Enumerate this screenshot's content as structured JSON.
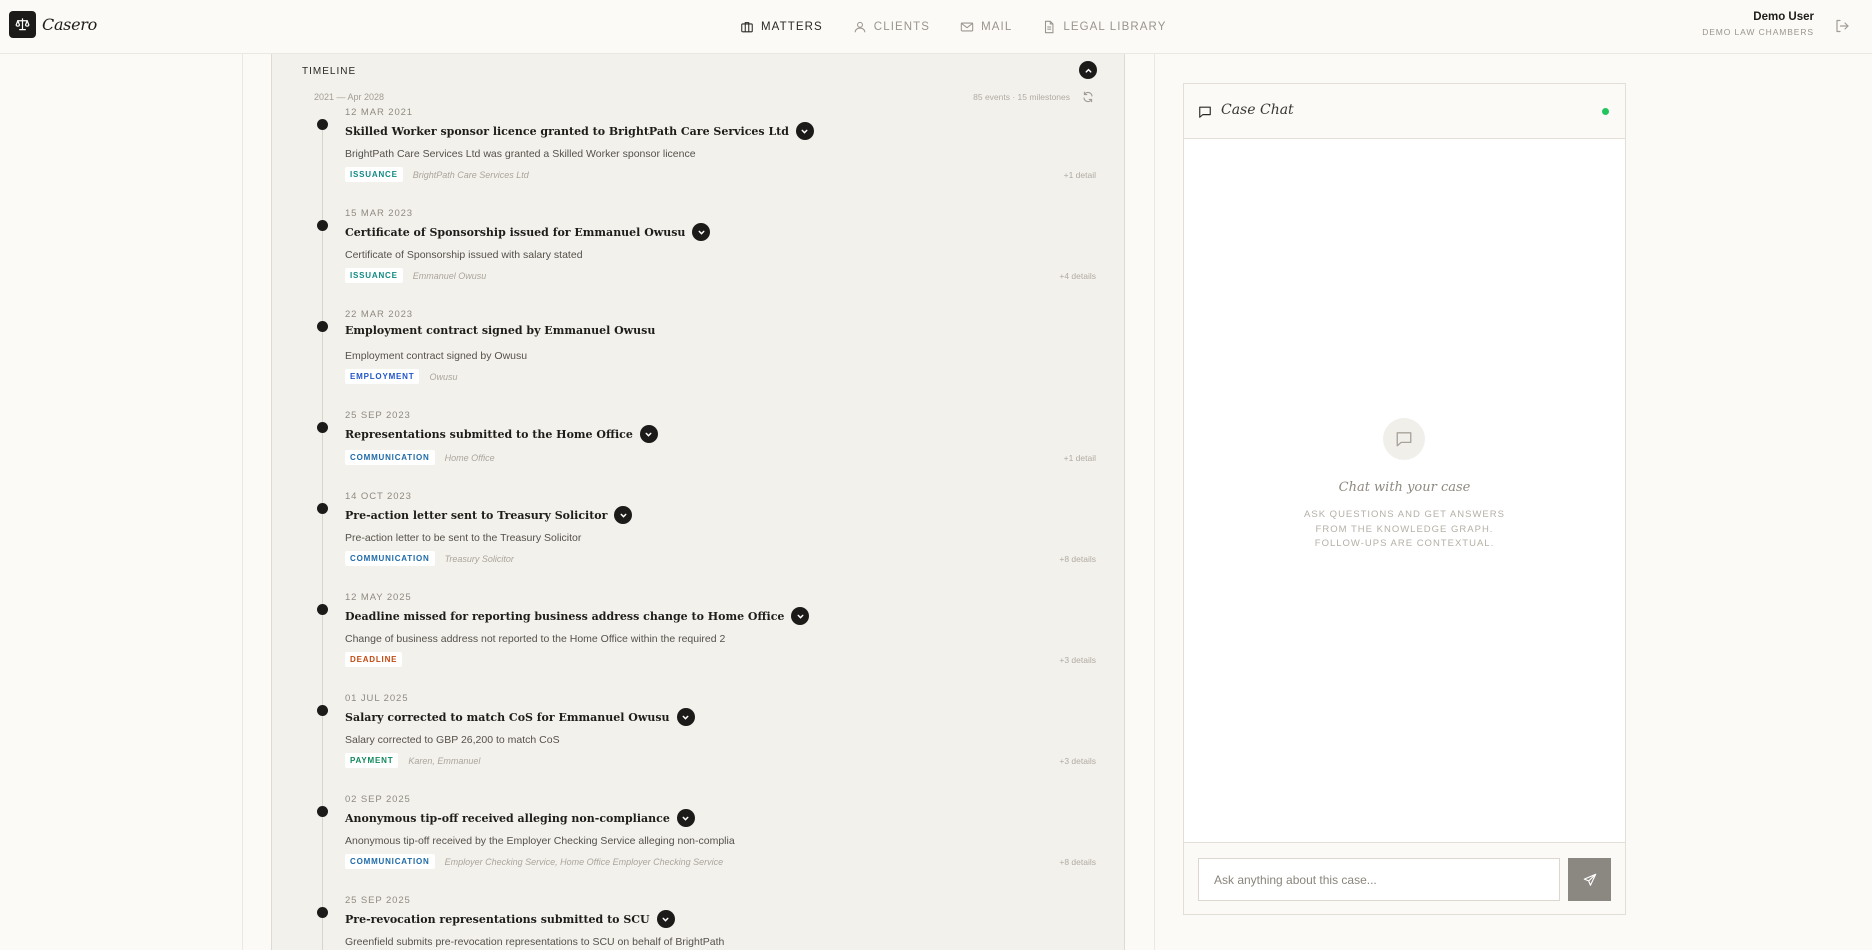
{
  "app": {
    "name": "Casero"
  },
  "nav": {
    "items": [
      {
        "label": "MATTERS",
        "icon": "briefcase-icon",
        "active": true
      },
      {
        "label": "CLIENTS",
        "icon": "user-icon",
        "active": false
      },
      {
        "label": "MAIL",
        "icon": "mail-icon",
        "active": false
      },
      {
        "label": "LEGAL LIBRARY",
        "icon": "document-icon",
        "active": false
      }
    ]
  },
  "user": {
    "name": "Demo User",
    "firm": "DEMO LAW CHAMBERS"
  },
  "timeline": {
    "title": "TIMELINE",
    "range": "2021 — Apr 2028",
    "stats": "85 events · 15 milestones",
    "events": [
      {
        "date": "12 MAR 2021",
        "title": "Skilled Worker sponsor licence granted to BrightPath Care Services Ltd",
        "expandable": true,
        "description": "BrightPath Care Services Ltd was granted a Skilled Worker sponsor licence",
        "tag": "ISSUANCE",
        "parties": "BrightPath Care Services Ltd",
        "details": "+1 detail"
      },
      {
        "date": "15 MAR 2023",
        "title": "Certificate of Sponsorship issued for Emmanuel Owusu",
        "expandable": true,
        "description": "Certificate of Sponsorship issued with salary stated",
        "tag": "ISSUANCE",
        "parties": "Emmanuel Owusu",
        "details": "+4 details"
      },
      {
        "date": "22 MAR 2023",
        "title": "Employment contract signed by Emmanuel Owusu",
        "expandable": false,
        "description": "Employment contract signed by Owusu",
        "tag": "EMPLOYMENT",
        "parties": "Owusu",
        "details": ""
      },
      {
        "date": "25 SEP 2023",
        "title": "Representations submitted to the Home Office",
        "expandable": true,
        "description": "",
        "tag": "COMMUNICATION",
        "parties": "Home Office",
        "details": "+1 detail"
      },
      {
        "date": "14 OCT 2023",
        "title": "Pre-action letter sent to Treasury Solicitor",
        "expandable": true,
        "description": "Pre-action letter to be sent to the Treasury Solicitor",
        "tag": "COMMUNICATION",
        "parties": "Treasury Solicitor",
        "details": "+8 details"
      },
      {
        "date": "12 MAY 2025",
        "title": "Deadline missed for reporting business address change to Home Office",
        "expandable": true,
        "description": "Change of business address not reported to the Home Office within the required 2",
        "tag": "DEADLINE",
        "parties": "",
        "details": "+3 details"
      },
      {
        "date": "01 JUL 2025",
        "title": "Salary corrected to match CoS for Emmanuel Owusu",
        "expandable": true,
        "description": "Salary corrected to GBP 26,200 to match CoS",
        "tag": "PAYMENT",
        "parties": "Karen, Emmanuel",
        "details": "+3 details"
      },
      {
        "date": "02 SEP 2025",
        "title": "Anonymous tip-off received alleging non-compliance",
        "expandable": true,
        "description": "Anonymous tip-off received by the Employer Checking Service alleging non-complia",
        "tag": "COMMUNICATION",
        "parties": "Employer Checking Service, Home Office Employer Checking Service",
        "details": "+8 details"
      },
      {
        "date": "25 SEP 2025",
        "title": "Pre-revocation representations submitted to SCU",
        "expandable": true,
        "description": "Greenfield submits pre-revocation representations to SCU on behalf of BrightPath",
        "tag": "",
        "parties": "",
        "details": ""
      }
    ]
  },
  "chat": {
    "title": "Case Chat",
    "empty_title": "Chat with your case",
    "empty_subtitle": "ASK QUESTIONS AND GET ANSWERS FROM THE KNOWLEDGE GRAPH. FOLLOW-UPS ARE CONTEXTUAL.",
    "input_placeholder": "Ask anything about this case...",
    "status_color": "#22c55e"
  }
}
